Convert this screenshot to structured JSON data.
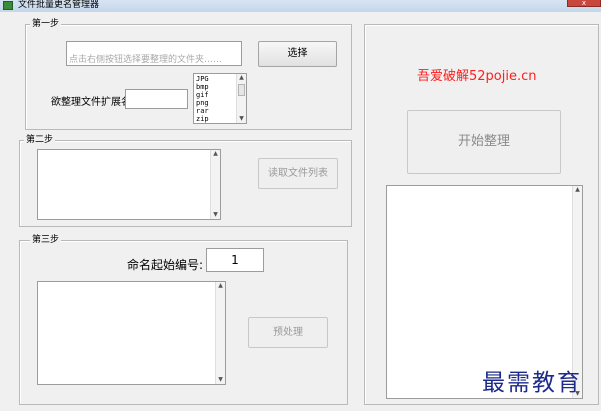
{
  "window": {
    "title": "文件批量更名管理器",
    "close_glyph": "x"
  },
  "step1": {
    "legend": "第一步",
    "path_placeholder": "点击右侧按钮选择要整理的文件夹……",
    "select_button": "选择",
    "ext_label": "欲整理文件扩展名:",
    "ext_value": "",
    "ext_list": [
      "JPG",
      "bmp",
      "gif",
      "png",
      "rar",
      "zip"
    ]
  },
  "step2": {
    "legend": "第二步",
    "read_button": "读取文件列表"
  },
  "step3": {
    "legend": "第三步",
    "start_label": "命名起始编号:",
    "start_value": "1",
    "preprocess_button": "预处理"
  },
  "right_panel": {
    "site_text": "吾爱破解52pojie.cn",
    "start_button": "开始整理"
  },
  "watermark": "最需教育",
  "colors": {
    "site_text": "#ff1e1e",
    "watermark": "#1d2a8a",
    "title_bar": "#c4d6ec"
  },
  "icons": {
    "app": "app-icon",
    "scroll_up": "scroll-up-icon",
    "scroll_down": "scroll-down-icon"
  }
}
